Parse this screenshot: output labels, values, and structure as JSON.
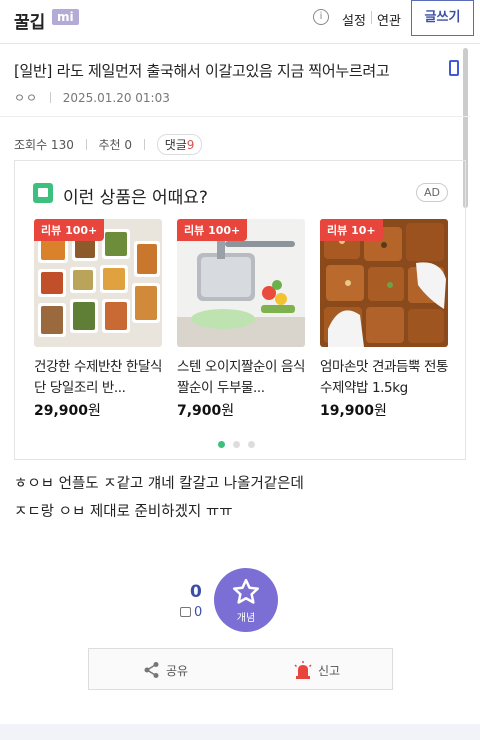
{
  "header": {
    "logo": "꿀깁",
    "logo_badge": "mi",
    "info_icon": "info-circle-icon",
    "links": [
      "설정",
      "연관"
    ],
    "write_button": "글쓰기"
  },
  "post": {
    "title": "[일반] 라도 제일먼저 출국해서 이갈고있음 지금 찍어누르려고",
    "author": "ㅇㅇ",
    "datetime": "2025.01.20 01:03",
    "views_label": "조회수 130",
    "recommend_label": "추천 0",
    "comments_label": "댓글",
    "comments_count": "9",
    "body_lines": [
      "ㅎㅇㅂ 언플도 ㅈ같고 걔네 칼갈고 나올거같은데",
      "ㅈㄷ랑 ㅇㅂ 제대로 준비하겠지 ㅠㅠ"
    ]
  },
  "ad": {
    "title": "이런 상품은 어때요?",
    "tag": "AD",
    "products": [
      {
        "review": "리뷰 100+",
        "name": "건강한 수제반찬 한달식단 당일조리 반...",
        "price": "29,900",
        "unit": "원"
      },
      {
        "review": "리뷰 100+",
        "name": "스텐 오이지짤순이 음식짤순이 두부물...",
        "price": "7,900",
        "unit": "원"
      },
      {
        "review": "리뷰 10+",
        "name": "엄마손맛 견과듬뿍 전통 수제약밥 1.5kg",
        "price": "19,900",
        "unit": "원"
      }
    ],
    "pager_active": 0
  },
  "vote": {
    "count": "0",
    "sub_count": "0",
    "concept_label": "개념"
  },
  "actions": {
    "share": "공유",
    "report": "신고"
  },
  "colors": {
    "accent": "#3c4fa8",
    "concept": "#7b6fd6",
    "review_badge": "#e8453c",
    "ad_green": "#3dbf7e"
  }
}
